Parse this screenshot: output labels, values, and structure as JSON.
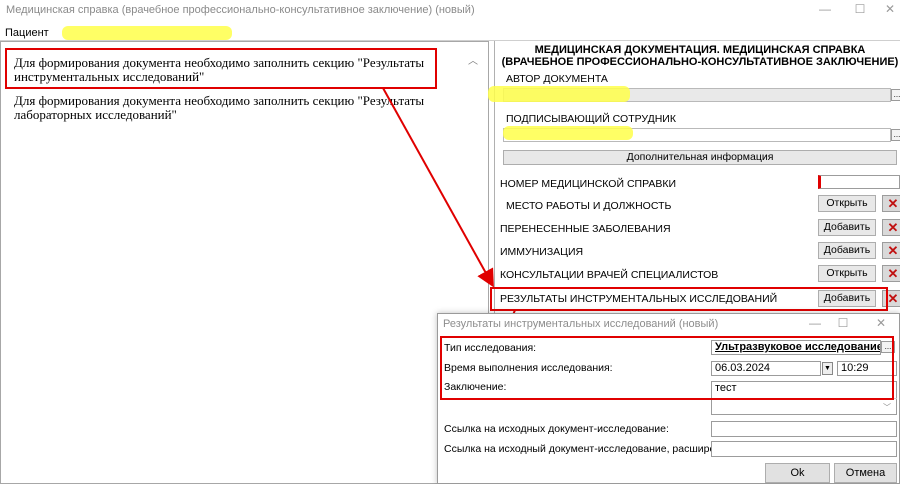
{
  "window": {
    "title": "Медицинская справка (врачебное профессионально-консультативное заключение) (новый)",
    "minimize": "—",
    "maximize": "☐",
    "close": "✕"
  },
  "patient": {
    "label": "Пациент"
  },
  "warnings": [
    "Для формирования документа необходимо заполнить секцию \"Результаты инструментальных исследований\"",
    "Для формирования документа необходимо заполнить секцию \"Результаты лабораторных исследований\""
  ],
  "form": {
    "title": "МЕДИЦИНСКАЯ ДОКУМЕНТАЦИЯ. МЕДИЦИНСКАЯ СПРАВКА (ВРАЧЕБНОЕ ПРОФЕССИОНАЛЬНО-КОНСУЛЬТАТИВНОЕ ЗАКЛЮЧЕНИЕ)",
    "author_label": "АВТОР ДОКУМЕНТА",
    "signer_label": "ПОДПИСЫВАЮЩИЙ СОТРУДНИК",
    "more_info_button": "Дополнительная информация",
    "dots": "...",
    "sections": [
      {
        "label": "НОМЕР МЕДИЦИНСКОЙ СПРАВКИ",
        "button": ""
      },
      {
        "label": "МЕСТО РАБОТЫ И ДОЛЖНОСТЬ",
        "button": "Открыть"
      },
      {
        "label": "ПЕРЕНЕСЕННЫЕ ЗАБОЛЕВАНИЯ",
        "button": "Добавить"
      },
      {
        "label": "ИММУНИЗАЦИЯ",
        "button": "Добавить"
      },
      {
        "label": "КОНСУЛЬТАЦИИ ВРАЧЕЙ СПЕЦИАЛИСТОВ",
        "button": "Открыть"
      },
      {
        "label": "РЕЗУЛЬТАТЫ ИНСТРУМЕНТАЛЬНЫХ ИССЛЕДОВАНИЙ",
        "button": "Добавить"
      }
    ],
    "remove_glyph": "✕"
  },
  "dialog": {
    "title": "Результаты инструментальных исследований (новый)",
    "minimize": "—",
    "maximize": "☐",
    "close": "✕",
    "type_label": "Тип исследования:",
    "type_value": "Ультразвуковое исследование ма",
    "time_label": "Время выполнения исследования:",
    "date_value": "06.03.2024",
    "time_value": "10:29",
    "conclusion_label": "Заключение:",
    "conclusion_value": "тест",
    "link_label": "Ссылка на исходных документ-исследование:",
    "link_ext_label": "Ссылка на исходный документ-исследование, расширение:",
    "ok_button": "Ok",
    "cancel_button": "Отмена",
    "dots": "..."
  },
  "colors": {
    "annotation_red": "#e00000",
    "highlight_yellow": "#ffff4a",
    "remove_red": "#c01010"
  }
}
